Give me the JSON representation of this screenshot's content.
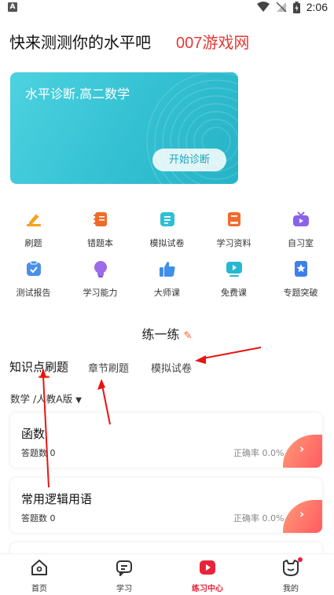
{
  "status_bar": {
    "time": "2:06",
    "left_badge": "A"
  },
  "header": {
    "title": "快来测测你的水平吧",
    "watermark": "007游戏网"
  },
  "banner": {
    "title": "水平诊断.高二数学",
    "button": "开始诊断"
  },
  "grid": [
    {
      "label": "刷题",
      "icon": "pencil-icon",
      "color": "#f7a21b"
    },
    {
      "label": "错题本",
      "icon": "notebook-icon",
      "color": "#f06a2a"
    },
    {
      "label": "模拟试卷",
      "icon": "exam-paper-icon",
      "color": "#2fbfd4"
    },
    {
      "label": "学习资料",
      "icon": "book-icon",
      "color": "#f26b2e"
    },
    {
      "label": "自习室",
      "icon": "tv-icon",
      "color": "#8a63e8"
    },
    {
      "label": "测试报告",
      "icon": "report-check-icon",
      "color": "#4a90e8"
    },
    {
      "label": "学习能力",
      "icon": "lightbulb-icon",
      "color": "#9d6be8"
    },
    {
      "label": "大师课",
      "icon": "thumbs-up-icon",
      "color": "#3f8fe8"
    },
    {
      "label": "免费课",
      "icon": "play-screen-icon",
      "color": "#28b7d2"
    },
    {
      "label": "专题突破",
      "icon": "star-bookmark-icon",
      "color": "#3f7fe8"
    }
  ],
  "practice": {
    "title": "练一练",
    "tabs": [
      "知识点刷题",
      "章节刷题",
      "模拟试卷"
    ],
    "filter": "数学 /人教A版"
  },
  "cards": [
    {
      "title": "函数",
      "count_label": "答题数 0",
      "rate_label": "正确率 0.0%"
    },
    {
      "title": "常用逻辑用语",
      "count_label": "答题数 0",
      "rate_label": "正确率 0.0%"
    }
  ],
  "bottom_nav": [
    {
      "label": "首页",
      "icon": "home-icon"
    },
    {
      "label": "学习",
      "icon": "study-icon"
    },
    {
      "label": "练习中心",
      "icon": "practice-icon"
    },
    {
      "label": "我的",
      "icon": "profile-icon"
    }
  ],
  "colors": {
    "accent": "#ff5722",
    "nav_active": "#e8233a",
    "banner": "#33c0d2"
  }
}
